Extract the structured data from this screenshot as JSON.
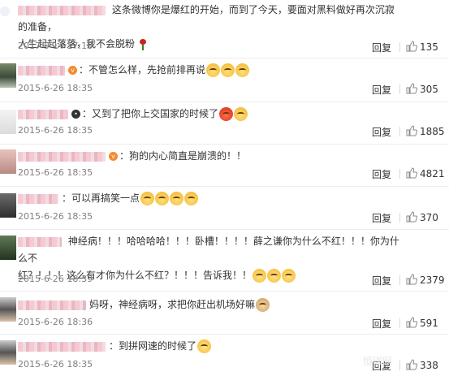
{
  "comments": [
    {
      "text": "这条微博你是爆红的开始，而到了今天，要面对黑料做好再次沉寂的准备，",
      "text2": "人生起起落落，我不会脱粉",
      "time": "2017-9-14 17:18",
      "reply": "回复",
      "likes": "135",
      "emoji": "rose"
    },
    {
      "text": "：不管怎么样，先抢前排再说",
      "time": "2015-6-26 18:35",
      "reply": "回复",
      "likes": "305",
      "emoji": [
        "y",
        "y",
        "y"
      ]
    },
    {
      "text": "：又到了把你上交国家的时候了",
      "time": "2015-6-26 18:35",
      "reply": "回复",
      "likes": "1885",
      "emoji": [
        "r",
        "r"
      ]
    },
    {
      "text": "：狗的内心简直是崩溃的！！",
      "time": "2015-6-26 18:35",
      "reply": "回复",
      "likes": "4821",
      "emoji": []
    },
    {
      "text": "：可以再搞笑一点",
      "time": "2015-6-26 18:35",
      "reply": "回复",
      "likes": "370",
      "emoji": [
        "y",
        "y",
        "y",
        "y"
      ]
    },
    {
      "text": "神经病！！！哈哈哈哈！！！卧槽！！！！薛之谦你为什么不红！！！你为什么不",
      "text2": "红？！！！这么有才你为什么不红？！！！告诉我！！",
      "time": "2015-6-26 18:39",
      "reply": "回复",
      "likes": "2379",
      "emoji": [
        "h",
        "h",
        "h"
      ]
    },
    {
      "text": "妈呀，神经病呀，求把你赶出机场好嘛",
      "time": "2015-6-26 18:36",
      "reply": "回复",
      "likes": "591",
      "emoji": [
        "c"
      ]
    },
    {
      "text": "：到拼网速的时候了",
      "time": "2015-6-26 18:35",
      "reply": "回复",
      "likes": "338",
      "emoji": [
        "h"
      ]
    }
  ],
  "watermark": "恒碳网"
}
